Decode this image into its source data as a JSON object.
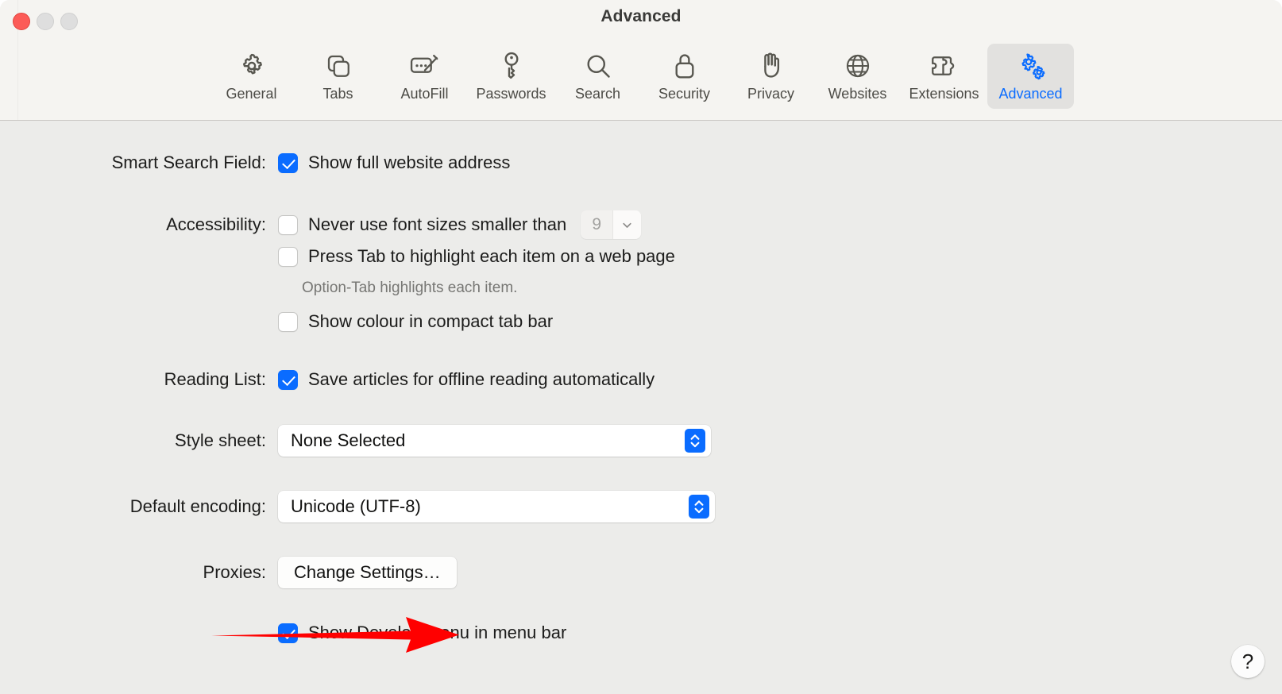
{
  "window": {
    "title": "Advanced",
    "traffic_lights": [
      "close",
      "minimise",
      "maximise"
    ]
  },
  "tabs": [
    {
      "label": "General",
      "icon": "gear-icon",
      "selected": false
    },
    {
      "label": "Tabs",
      "icon": "tabs-icon",
      "selected": false
    },
    {
      "label": "AutoFill",
      "icon": "autofill-icon",
      "selected": false
    },
    {
      "label": "Passwords",
      "icon": "key-icon",
      "selected": false
    },
    {
      "label": "Search",
      "icon": "search-icon",
      "selected": false
    },
    {
      "label": "Security",
      "icon": "lock-icon",
      "selected": false
    },
    {
      "label": "Privacy",
      "icon": "hand-icon",
      "selected": false
    },
    {
      "label": "Websites",
      "icon": "globe-icon",
      "selected": false
    },
    {
      "label": "Extensions",
      "icon": "puzzle-icon",
      "selected": false
    },
    {
      "label": "Advanced",
      "icon": "gears-icon",
      "selected": true
    }
  ],
  "settings": {
    "smart_search": {
      "label": "Smart Search Field:",
      "checkbox_label": "Show full website address",
      "checked": true
    },
    "accessibility": {
      "label": "Accessibility:",
      "min_font": {
        "checkbox_label": "Never use font sizes smaller than",
        "checked": false,
        "value": "9"
      },
      "tab_highlight": {
        "checkbox_label": "Press Tab to highlight each item on a web page",
        "checked": false,
        "hint": "Option-Tab highlights each item."
      },
      "compact_tab_colour": {
        "checkbox_label": "Show colour in compact tab bar",
        "checked": false
      }
    },
    "reading_list": {
      "label": "Reading List:",
      "checkbox_label": "Save articles for offline reading automatically",
      "checked": true
    },
    "style_sheet": {
      "label": "Style sheet:",
      "value": "None Selected"
    },
    "default_encoding": {
      "label": "Default encoding:",
      "value": "Unicode (UTF-8)"
    },
    "proxies": {
      "label": "Proxies:",
      "button_label": "Change Settings…"
    },
    "develop_menu": {
      "checkbox_label": "Show Develop menu in menu bar",
      "checked": true
    }
  },
  "help_button": {
    "glyph": "?"
  },
  "annotation": {
    "type": "arrow",
    "colour": "#FF0000",
    "points_to": "Show Develop menu in menu bar"
  },
  "colours": {
    "accent": "#0A6CFF",
    "toolbar_bg": "#F5F4F1",
    "content_bg": "#ECECEA",
    "selected_tab_bg": "#E2E1DF",
    "annotation_red": "#FF0000"
  }
}
